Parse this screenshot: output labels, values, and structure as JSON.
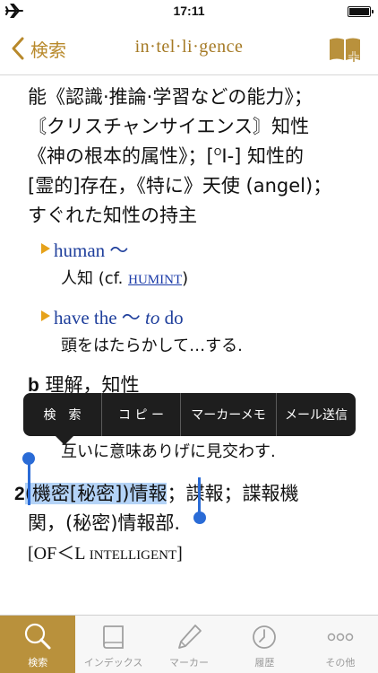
{
  "status_bar": {
    "time": "17:11"
  },
  "nav": {
    "back_label": "検索",
    "title": "in·tel·li·gence"
  },
  "entry": {
    "line1": "能《認識·推論·学習などの能力》；",
    "line2": "〘クリスチャンサイエンス〙知性",
    "line3a": "《神の根本的属性》；[",
    "line3_sup": "O",
    "line3b": "I-] 知性的",
    "line4": "[霊的]存在，《特に》天使 (angel)；",
    "line5": "すぐれた知性の持主",
    "phrase1": "human 〜",
    "phrase1_gloss_a": "人知 (cf. ",
    "phrase1_link": "HUMINT",
    "phrase1_gloss_b": ")",
    "phrase2_a": "have the 〜 ",
    "phrase2_em": "to",
    "phrase2_b": " do",
    "phrase2_gloss": "頭をはたらかして…する.",
    "sense_b_letter": "b",
    "sense_b_text": "理解，知性",
    "sense_b_example": "互いに意味ありげに見交わす.",
    "sense_2_number": "2",
    "sense_2_selected": "(機密[秘密])情報",
    "sense_2_rest": "；諜報；諜報機",
    "sense_2_line2": "関，(秘密)情報部.",
    "etym_a": "[OF＜L ",
    "etym_sc": "INTELLIGENT",
    "etym_b": "]"
  },
  "context_menu": [
    "検　索",
    "コ ピ ー",
    "マーカーメモ",
    "メール送信"
  ],
  "tabs": [
    {
      "label": "検索",
      "icon": "search-icon",
      "active": true
    },
    {
      "label": "インデックス",
      "icon": "book-icon",
      "active": false
    },
    {
      "label": "マーカー",
      "icon": "marker-pen-icon",
      "active": false
    },
    {
      "label": "履歴",
      "icon": "history-clock-icon",
      "active": false
    },
    {
      "label": "その他",
      "icon": "more-dots-icon",
      "active": false
    }
  ],
  "colors": {
    "accent": "#b9913c",
    "link_blue": "#1f3f9c",
    "selection": "#b4d3f7",
    "handle": "#2a6bd6"
  }
}
